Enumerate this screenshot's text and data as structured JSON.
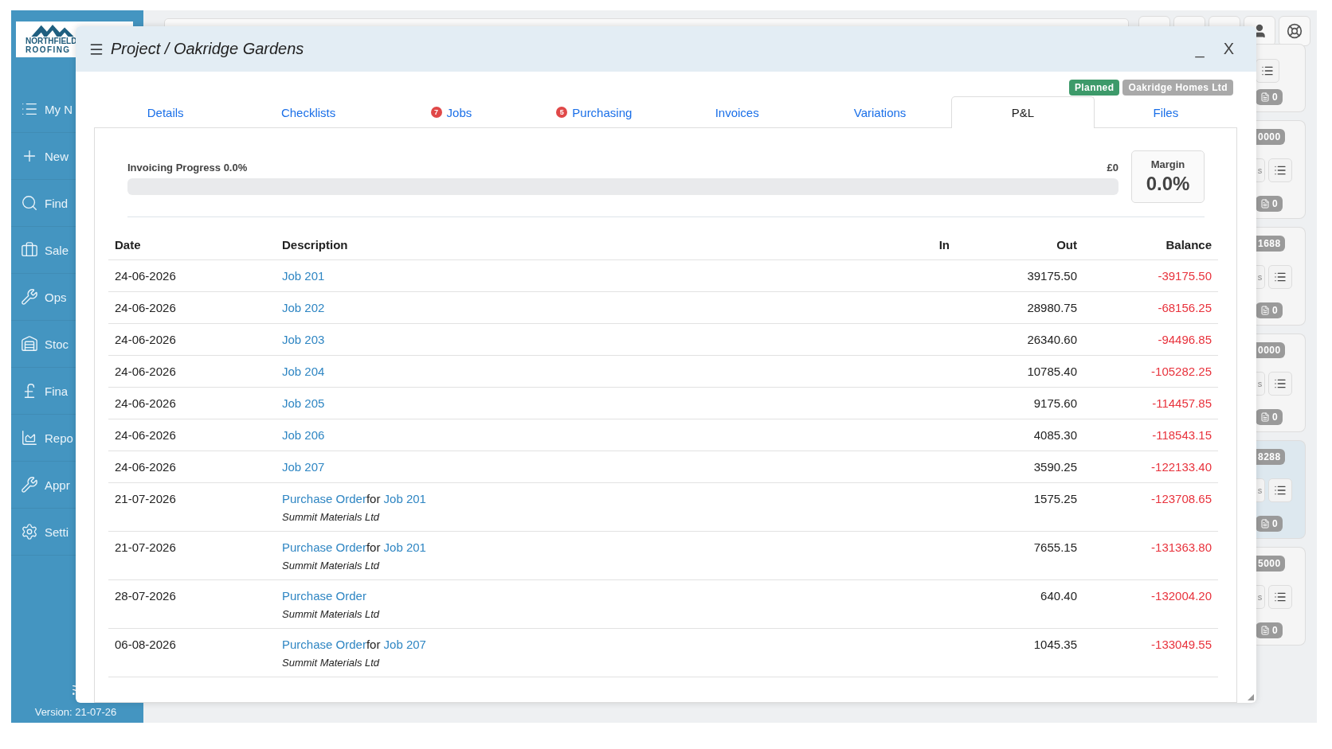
{
  "app": {
    "logo": {
      "line1": "NORTHFIELD",
      "line2": "ROOFING"
    },
    "nav": [
      {
        "kind": "list",
        "label": "My N"
      },
      {
        "kind": "plus",
        "label": "New"
      },
      {
        "kind": "search",
        "label": "Find"
      },
      {
        "kind": "briefcase",
        "label": "Sale"
      },
      {
        "kind": "wrench",
        "label": "Ops"
      },
      {
        "kind": "warehouse",
        "label": "Stoc"
      },
      {
        "kind": "pound",
        "label": "Fina"
      },
      {
        "kind": "chart",
        "label": "Repo"
      },
      {
        "kind": "wrench",
        "label": "Appr"
      },
      {
        "kind": "gear",
        "label": "Setti"
      }
    ],
    "version": "Version: 21-07-26",
    "side_cards": [
      {
        "doc_count": "0",
        "selected": false
      },
      {
        "amount": "0000",
        "fragment": "s",
        "doc_count": "0",
        "selected": false
      },
      {
        "amount": "1688",
        "fragment": "s",
        "doc_count": "0",
        "selected": false
      },
      {
        "amount": "0000",
        "fragment": "s",
        "doc_count": "0",
        "selected": false
      },
      {
        "amount": "8288",
        "fragment": "s",
        "doc_count": "0",
        "selected": true
      },
      {
        "amount": "5000",
        "fragment": "s",
        "doc_count": "0",
        "selected": false
      }
    ]
  },
  "modal": {
    "title": "Project / Oakridge Gardens",
    "minimize": "_",
    "close": "X",
    "status_badges": [
      {
        "label": "Planned",
        "color": "#3d9a6a"
      },
      {
        "label": "Oakridge Homes Ltd",
        "color": "#a9a9a9"
      }
    ],
    "tabs": [
      {
        "label": "Details",
        "selected": false
      },
      {
        "label": "Checklists",
        "selected": false
      },
      {
        "label": "Jobs",
        "count": "7",
        "selected": false
      },
      {
        "label": "Purchasing",
        "count": "5",
        "selected": false
      },
      {
        "label": "Invoices",
        "selected": false
      },
      {
        "label": "Variations",
        "selected": false
      },
      {
        "label": "P&L",
        "selected": true
      },
      {
        "label": "Files",
        "selected": false
      }
    ],
    "invoicing": {
      "label": "Invoicing Progress 0.0%",
      "amount": "£0",
      "level": 0
    },
    "margin": {
      "label": "Margin",
      "value": "0.0%"
    },
    "table": {
      "columns": [
        "Date",
        "Description",
        "In",
        "Out",
        "Balance"
      ],
      "rows": [
        {
          "date": "24-06-2026",
          "description": [
            {
              "text": "Job 201",
              "link": true
            }
          ],
          "out": "39175.50",
          "balance": "-39175.50"
        },
        {
          "date": "24-06-2026",
          "description": [
            {
              "text": "Job 202",
              "link": true
            }
          ],
          "out": "28980.75",
          "balance": "-68156.25"
        },
        {
          "date": "24-06-2026",
          "description": [
            {
              "text": "Job 203",
              "link": true
            }
          ],
          "out": "26340.60",
          "balance": "-94496.85"
        },
        {
          "date": "24-06-2026",
          "description": [
            {
              "text": "Job 204",
              "link": true
            }
          ],
          "out": "10785.40",
          "balance": "-105282.25"
        },
        {
          "date": "24-06-2026",
          "description": [
            {
              "text": "Job 205",
              "link": true
            }
          ],
          "out": "9175.60",
          "balance": "-114457.85"
        },
        {
          "date": "24-06-2026",
          "description": [
            {
              "text": "Job 206",
              "link": true
            }
          ],
          "out": "4085.30",
          "balance": "-118543.15"
        },
        {
          "date": "24-06-2026",
          "description": [
            {
              "text": "Job 207",
              "link": true
            }
          ],
          "out": "3590.25",
          "balance": "-122133.40"
        },
        {
          "date": "21-07-2026",
          "description": [
            {
              "text": "Purchase Order",
              "link": true
            },
            {
              "text": "for",
              "link": false
            },
            {
              "text": " Job 201",
              "link": true
            }
          ],
          "supplier": "Summit Materials Ltd",
          "out": "1575.25",
          "balance": "-123708.65"
        },
        {
          "date": "21-07-2026",
          "description": [
            {
              "text": "Purchase Order",
              "link": true
            },
            {
              "text": "for",
              "link": false
            },
            {
              "text": " Job 201",
              "link": true
            }
          ],
          "supplier": "Summit Materials Ltd",
          "out": "7655.15",
          "balance": "-131363.80"
        },
        {
          "date": "28-07-2026",
          "description": [
            {
              "text": "Purchase Order",
              "link": true
            }
          ],
          "supplier": "Summit Materials Ltd",
          "out": "640.40",
          "balance": "-132004.20"
        },
        {
          "date": "06-08-2026",
          "description": [
            {
              "text": "Purchase Order",
              "link": true
            },
            {
              "text": "for",
              "link": false
            },
            {
              "text": " Job 207",
              "link": true
            }
          ],
          "supplier": "Summit Materials Ltd",
          "out": "1045.35",
          "balance": "-133049.55"
        }
      ]
    }
  }
}
